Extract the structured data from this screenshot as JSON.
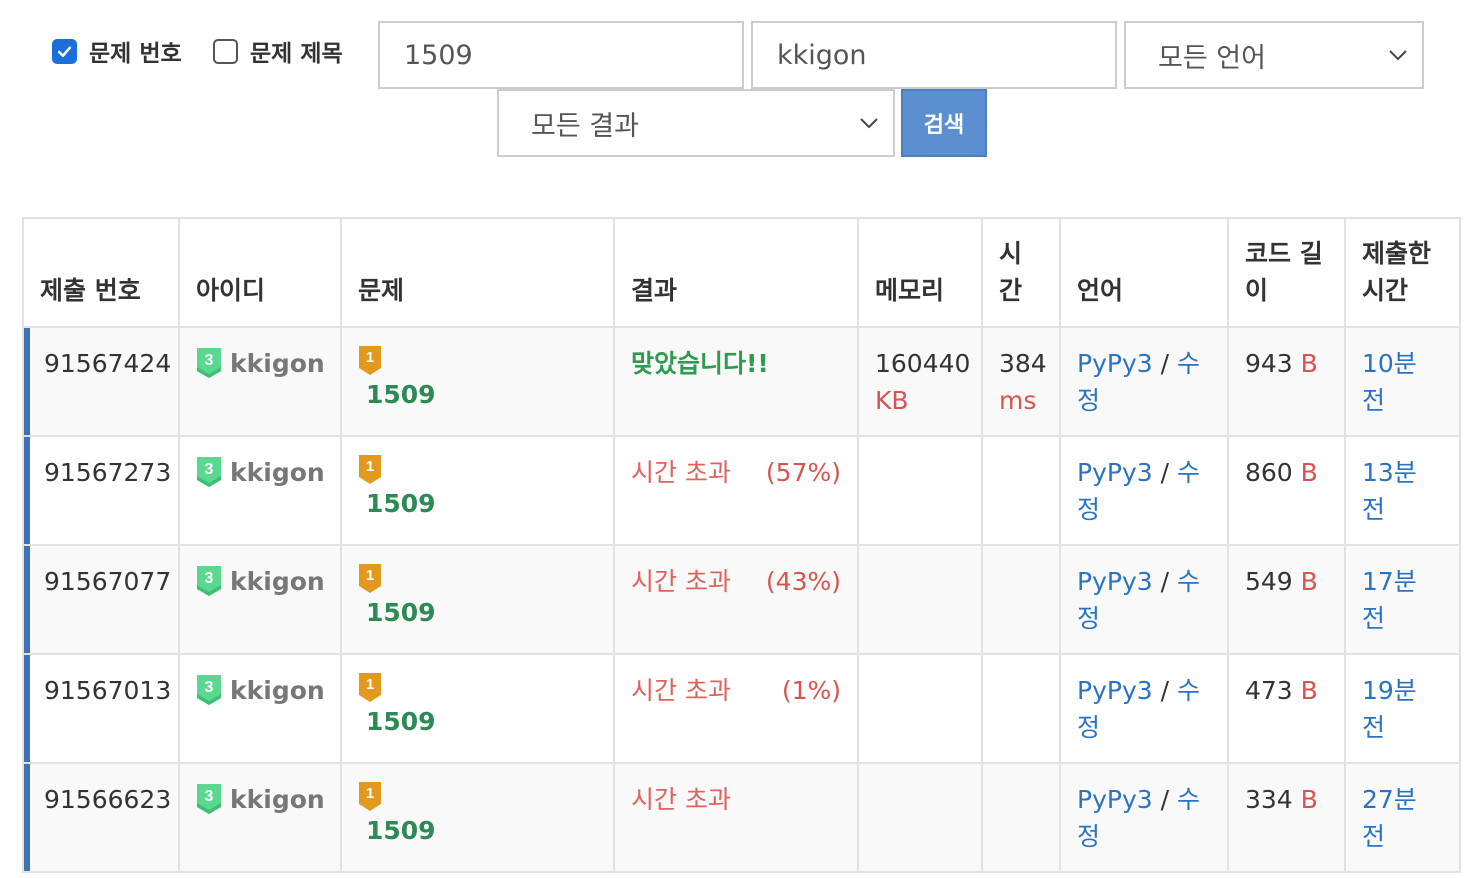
{
  "search": {
    "check_problem_id": {
      "label": "문제 번호",
      "checked": true
    },
    "check_problem_title": {
      "label": "문제 제목",
      "checked": false
    },
    "problem_value": "1509",
    "user_value": "kkigon",
    "language_selected": "모든 언어",
    "result_selected": "모든 결과",
    "search_button": "검색"
  },
  "table": {
    "headers": {
      "submission_id": "제출 번호",
      "user_id": "아이디",
      "problem": "문제",
      "result": "결과",
      "memory": "메모리",
      "time": "시간",
      "language": "언어",
      "code_length": "코드 길이",
      "submitted_at": "제출한 시간"
    },
    "rows": [
      {
        "id": "91567424",
        "tier": "3",
        "user": "kkigon",
        "problem_level": "1",
        "problem": "1509",
        "result": "맞았습니다!!",
        "result_pct": "",
        "memory": "160440",
        "memory_unit": "KB",
        "time": "384",
        "time_unit": "ms",
        "lang": "PyPy3",
        "sep": "/",
        "edit": "수정",
        "length": "943",
        "length_unit": "B",
        "ago": "10분 전"
      },
      {
        "id": "91567273",
        "tier": "3",
        "user": "kkigon",
        "problem_level": "1",
        "problem": "1509",
        "result": "시간 초과",
        "result_pct": "(57%)",
        "memory": "",
        "memory_unit": "",
        "time": "",
        "time_unit": "",
        "lang": "PyPy3",
        "sep": "/",
        "edit": "수정",
        "length": "860",
        "length_unit": "B",
        "ago": "13분 전"
      },
      {
        "id": "91567077",
        "tier": "3",
        "user": "kkigon",
        "problem_level": "1",
        "problem": "1509",
        "result": "시간 초과",
        "result_pct": "(43%)",
        "memory": "",
        "memory_unit": "",
        "time": "",
        "time_unit": "",
        "lang": "PyPy3",
        "sep": "/",
        "edit": "수정",
        "length": "549",
        "length_unit": "B",
        "ago": "17분 전"
      },
      {
        "id": "91567013",
        "tier": "3",
        "user": "kkigon",
        "problem_level": "1",
        "problem": "1509",
        "result": "시간 초과",
        "result_pct": "(1%)",
        "memory": "",
        "memory_unit": "",
        "time": "",
        "time_unit": "",
        "lang": "PyPy3",
        "sep": "/",
        "edit": "수정",
        "length": "473",
        "length_unit": "B",
        "ago": "19분 전"
      },
      {
        "id": "91566623",
        "tier": "3",
        "user": "kkigon",
        "problem_level": "1",
        "problem": "1509",
        "result": "시간 초과",
        "result_pct": "",
        "memory": "",
        "memory_unit": "",
        "time": "",
        "time_unit": "",
        "lang": "PyPy3",
        "sep": "/",
        "edit": "수정",
        "length": "334",
        "length_unit": "B",
        "ago": "27분 전"
      }
    ]
  },
  "colors": {
    "accept": "#2f9b4f",
    "tle": "#e0625b",
    "link": "#2a73c4",
    "row_accent": "#3f72b2",
    "tier_badge": "#5ad88f",
    "problem_badge": "#e39a1c",
    "search_button": "#5b8fd0"
  },
  "icons": {
    "checkbox_checked": "check-icon",
    "dropdown": "chevron-down-icon",
    "user_tier": "class-badge-icon",
    "problem_tier": "bronze-tier-icon"
  }
}
